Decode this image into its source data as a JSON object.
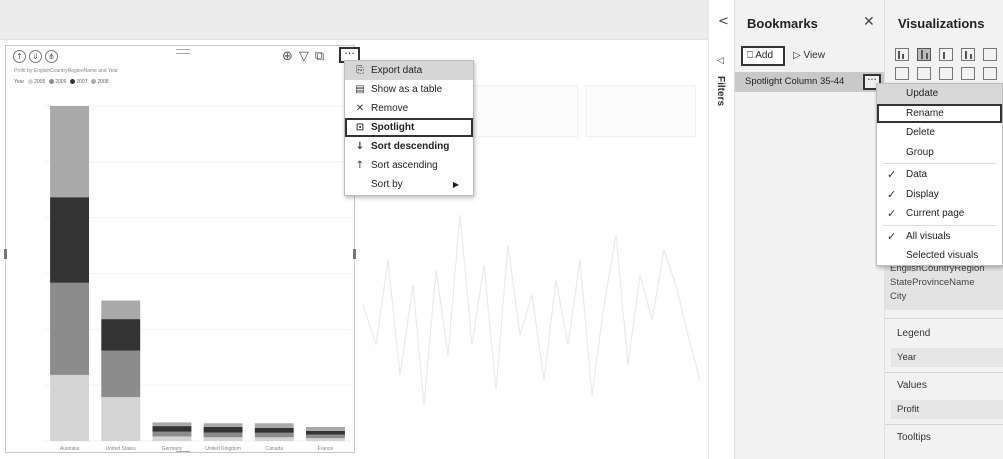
{
  "visual": {
    "legend_label": "Year",
    "legend_items": [
      {
        "label": "2005",
        "color": "#d4d4d4"
      },
      {
        "label": "2006",
        "color": "#8c8c8c"
      },
      {
        "label": "2007",
        "color": "#333333"
      },
      {
        "label": "2008",
        "color": "#a9a9a9"
      }
    ],
    "icons": {
      "drill_up": "arrow-up-icon",
      "drill_mode": "double-arrow-icon",
      "expand": "expand-icon",
      "drill_down": "arrow-down-icon",
      "filter": "filter-icon",
      "focus": "focus-mode-icon",
      "more": "more-options-icon"
    }
  },
  "context_menu": {
    "items": [
      {
        "label": "Export data",
        "icon": "export-icon"
      },
      {
        "label": "Show as a table",
        "icon": "table-icon"
      },
      {
        "label": "Remove",
        "icon": "close-icon"
      },
      {
        "label": "Spotlight",
        "icon": "spotlight-icon"
      },
      {
        "label": "Sort descending",
        "icon": "sort-descending-icon"
      },
      {
        "label": "Sort ascending",
        "icon": "sort-ascending-icon"
      },
      {
        "label": "Sort by",
        "icon": "chevron-right-icon"
      }
    ]
  },
  "filters": {
    "label": "Filters"
  },
  "bookmarks": {
    "title": "Bookmarks",
    "add_label": "Add",
    "view_label": "View",
    "item_label": "Spotlight Column 35-44"
  },
  "bookmark_menu": {
    "update": "Update",
    "rename": "Rename",
    "delete": "Delete",
    "group": "Group",
    "data": "Data",
    "display": "Display",
    "current_page": "Current page",
    "all_visuals": "All visuals",
    "selected_visuals": "Selected visuals"
  },
  "visualizations": {
    "title": "Visualizations",
    "fields": [
      "EnglishCountryRegion",
      "StateProvinceName",
      "City"
    ],
    "legend_label": "Legend",
    "legend_value": "Year",
    "values_label": "Values",
    "values_value": "Profit",
    "tooltips_label": "Tooltips"
  },
  "chart_data": {
    "type": "bar",
    "stacked": true,
    "categories": [
      "Australia",
      "United States",
      "Germany",
      "United Kingdom",
      "Canada",
      "France"
    ],
    "series": [
      {
        "name": "2005",
        "color": "#d4d4d4",
        "values": [
          0.71,
          0.47,
          0.05,
          0.04,
          0.04,
          0.03
        ]
      },
      {
        "name": "2006",
        "color": "#8c8c8c",
        "values": [
          0.99,
          0.5,
          0.05,
          0.05,
          0.05,
          0.04
        ]
      },
      {
        "name": "2007",
        "color": "#333333",
        "values": [
          0.92,
          0.34,
          0.06,
          0.06,
          0.05,
          0.04
        ]
      },
      {
        "name": "2008",
        "color": "#a9a9a9",
        "values": [
          0.98,
          0.2,
          0.04,
          0.04,
          0.05,
          0.04
        ]
      }
    ],
    "ylim": [
      0,
      3.6
    ]
  }
}
